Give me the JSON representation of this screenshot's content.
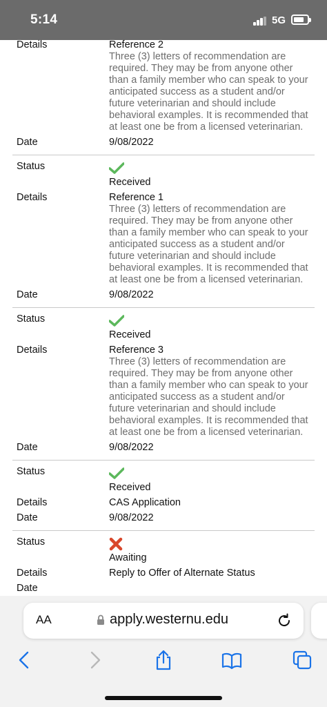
{
  "status_bar": {
    "time": "5:14",
    "network": "5G"
  },
  "labels": {
    "status": "Status",
    "details": "Details",
    "date": "Date"
  },
  "records": [
    {
      "title": "Reference 2",
      "description": "Three (3) letters of recommendation are required. They may be from anyone other than a family member who can speak to your anticipated success as a student and/or future veterinarian and should include behavioral examples. It is recommended that at least one be from a licensed veterinarian.",
      "date": "9/08/2022"
    },
    {
      "status": "Received",
      "status_icon": "check-icon",
      "title": "Reference 1",
      "description": "Three (3) letters of recommendation are required. They may be from anyone other than a family member who can speak to your anticipated success as a student and/or future veterinarian and should include behavioral examples. It is recommended that at least one be from a licensed veterinarian.",
      "date": "9/08/2022"
    },
    {
      "status": "Received",
      "status_icon": "check-icon",
      "title": "Reference 3",
      "description": "Three (3) letters of recommendation are required. They may be from anyone other than a family member who can speak to your anticipated success as a student and/or future veterinarian and should include behavioral examples. It is recommended that at least one be from a licensed veterinarian.",
      "date": "9/08/2022"
    },
    {
      "status": "Received",
      "status_icon": "check-icon",
      "title": "CAS Application",
      "date": "9/08/2022"
    },
    {
      "status": "Awaiting",
      "status_icon": "x-icon",
      "title": "Reply to Offer of Alternate Status",
      "date": ""
    }
  ],
  "browser": {
    "text_size_button": "AA",
    "url": "apply.westernu.edu"
  },
  "colors": {
    "check": "#5cb85c",
    "x": "#d9472b",
    "accent": "#1a73e8"
  }
}
